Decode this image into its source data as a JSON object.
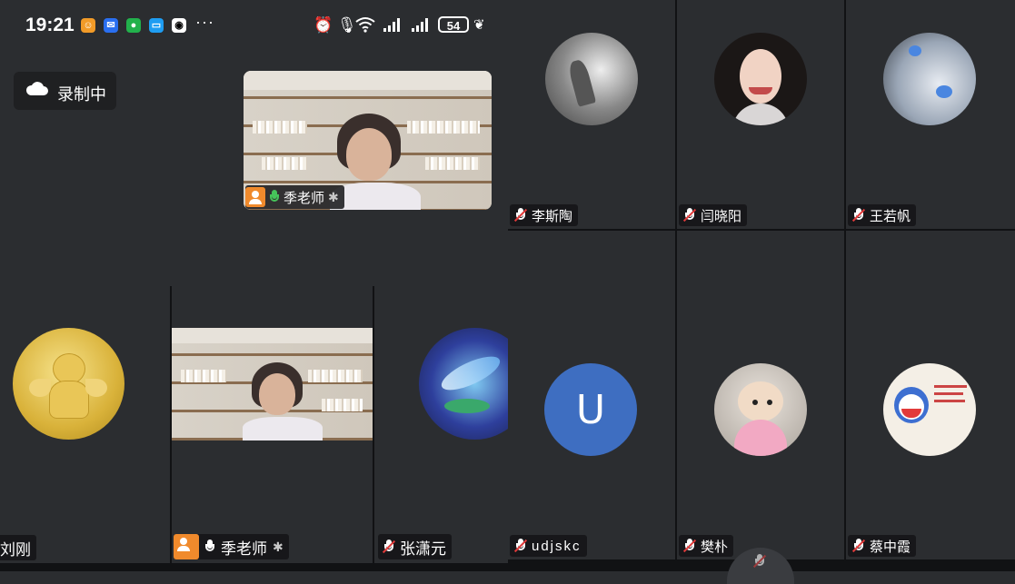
{
  "status_bar": {
    "time": "19:21",
    "battery": "54",
    "app_icons": [
      "app-icon-orange",
      "app-icon-blue",
      "wechat-icon",
      "message-icon",
      "qq-icon"
    ],
    "more": "···"
  },
  "recording": {
    "label": "录制中"
  },
  "participants": [
    {
      "name": "季老师",
      "tile": "presenter-top"
    },
    {
      "name": "李斯陶"
    },
    {
      "name": "闫晓阳"
    },
    {
      "name": "王若帆"
    },
    {
      "name": "刘刚"
    },
    {
      "name": "季老师",
      "tile": "presenter-bottom"
    },
    {
      "name": "张潇元"
    },
    {
      "name": "udjskc",
      "avatar_letter": "U"
    },
    {
      "name": "樊朴"
    },
    {
      "name": "蔡中霞"
    }
  ],
  "colors": {
    "background": "#2b2d30",
    "host_badge": "#f08a2c",
    "muted_slash": "#e03a3a",
    "mic_active": "#46c35a",
    "letter_avatar": "#3e6ec1"
  }
}
